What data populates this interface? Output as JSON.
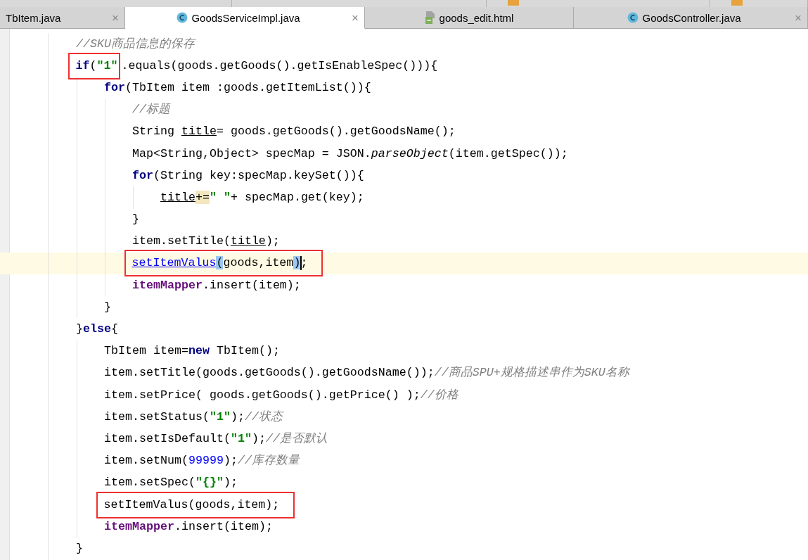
{
  "upper_tabs": [
    {
      "kind": "plain"
    },
    {
      "kind": "plain"
    },
    {
      "kind": "script"
    },
    {
      "kind": "script"
    }
  ],
  "tabs": [
    {
      "kind": "plain",
      "label": "TbItem.java",
      "close": "×",
      "selected": false
    },
    {
      "kind": "class",
      "label": "GoodsServiceImpl.java",
      "close": "×",
      "selected": true
    },
    {
      "kind": "html",
      "label": "goods_edit.html",
      "selected": false
    },
    {
      "kind": "class",
      "label": "GoodsController.java",
      "close": "×",
      "selected": false
    }
  ],
  "editor": {
    "lines": [
      {
        "current": false,
        "tokens": [
          {
            "kind": "comment",
            "text": "//SKU商品信息的保存"
          }
        ]
      },
      {
        "current": false,
        "segments": [
          {
            "kind": "framed",
            "tokens": [
              {
                "kind": "keyword",
                "text": "if"
              },
              {
                "kind": "plain",
                "text": "("
              },
              {
                "kind": "string",
                "text": "\"1\""
              }
            ]
          },
          {
            "kind": "plain",
            "tokens": [
              {
                "kind": "plain",
                "text": ".equals(goods.getGoods().getIsEnableSpec())){"
              }
            ]
          }
        ],
        "children": [
          {
            "current": false,
            "tokens": [
              {
                "kind": "keyword",
                "text": "for"
              },
              {
                "kind": "plain",
                "text": "(TbItem item :goods.getItemList()){"
              }
            ],
            "children": [
              {
                "current": false,
                "tokens": [
                  {
                    "kind": "comment",
                    "text": "//标题"
                  }
                ]
              },
              {
                "current": false,
                "tokens": [
                  {
                    "kind": "plain",
                    "text": "String "
                  },
                  {
                    "kind": "local",
                    "text": "title"
                  },
                  {
                    "kind": "plain",
                    "text": "= goods.getGoods().getGoodsName();"
                  }
                ]
              },
              {
                "current": false,
                "tokens": [
                  {
                    "kind": "plain",
                    "text": "Map<String,Object> specMap = JSON."
                  },
                  {
                    "kind": "static",
                    "text": "parseObject"
                  },
                  {
                    "kind": "plain",
                    "text": "(item.getSpec());"
                  }
                ]
              },
              {
                "current": false,
                "tokens": [
                  {
                    "kind": "keyword",
                    "text": "for"
                  },
                  {
                    "kind": "plain",
                    "text": "(String key:specMap.keySet()){"
                  }
                ],
                "children": [
                  {
                    "current": false,
                    "tokens": [
                      {
                        "kind": "local",
                        "text": "title"
                      },
                      {
                        "kind": "usage",
                        "text": "+="
                      },
                      {
                        "kind": "string",
                        "text": "\" \""
                      },
                      {
                        "kind": "plain",
                        "text": "+ specMap.get(key);"
                      }
                    ]
                  }
                ]
              },
              {
                "current": false,
                "tokens": [
                  {
                    "kind": "plain",
                    "text": "}"
                  }
                ]
              },
              {
                "current": false,
                "tokens": [
                  {
                    "kind": "plain",
                    "text": "item.setTitle("
                  },
                  {
                    "kind": "local",
                    "text": "title"
                  },
                  {
                    "kind": "plain",
                    "text": ");"
                  }
                ]
              },
              {
                "current": true,
                "segments": [
                  {
                    "kind": "framed",
                    "tokens": [
                      {
                        "kind": "link",
                        "text": "setItemValus"
                      },
                      {
                        "kind": "brace_match",
                        "text": "("
                      },
                      {
                        "kind": "plain",
                        "text": "goods,item"
                      },
                      {
                        "kind": "brace_match",
                        "text": ")"
                      },
                      {
                        "kind": "caret"
                      },
                      {
                        "kind": "plain",
                        "text": ";"
                      }
                    ]
                  }
                ]
              },
              {
                "current": false,
                "tokens": [
                  {
                    "kind": "field",
                    "text": "itemMapper"
                  },
                  {
                    "kind": "plain",
                    "text": ".insert(item);"
                  }
                ]
              }
            ]
          },
          {
            "current": false,
            "tokens": [
              {
                "kind": "plain",
                "text": "}"
              }
            ]
          }
        ]
      },
      {
        "current": false,
        "tokens": [
          {
            "kind": "plain",
            "text": "}"
          },
          {
            "kind": "keyword",
            "text": "else"
          },
          {
            "kind": "plain",
            "text": "{"
          }
        ],
        "children": [
          {
            "current": false,
            "tokens": [
              {
                "kind": "plain",
                "text": "TbItem item="
              },
              {
                "kind": "keyword",
                "text": "new"
              },
              {
                "kind": "plain",
                "text": " TbItem();"
              }
            ]
          },
          {
            "current": false,
            "tokens": [
              {
                "kind": "plain",
                "text": "item.setTitle(goods.getGoods().getGoodsName());"
              },
              {
                "kind": "comment",
                "text": "//商品SPU+规格描述串作为SKU名称"
              }
            ]
          },
          {
            "current": false,
            "tokens": [
              {
                "kind": "plain",
                "text": "item.setPrice( goods.getGoods().getPrice() );"
              },
              {
                "kind": "comment",
                "text": "//价格"
              }
            ]
          },
          {
            "current": false,
            "tokens": [
              {
                "kind": "plain",
                "text": "item.setStatus("
              },
              {
                "kind": "string",
                "text": "\"1\""
              },
              {
                "kind": "plain",
                "text": ");"
              },
              {
                "kind": "comment",
                "text": "//状态"
              }
            ]
          },
          {
            "current": false,
            "tokens": [
              {
                "kind": "plain",
                "text": "item.setIsDefault("
              },
              {
                "kind": "string",
                "text": "\"1\""
              },
              {
                "kind": "plain",
                "text": ");"
              },
              {
                "kind": "comment",
                "text": "//是否默认"
              }
            ]
          },
          {
            "current": false,
            "tokens": [
              {
                "kind": "plain",
                "text": "item.setNum("
              },
              {
                "kind": "number",
                "text": "99999"
              },
              {
                "kind": "plain",
                "text": ");"
              },
              {
                "kind": "comment",
                "text": "//库存数量"
              }
            ]
          },
          {
            "current": false,
            "tokens": [
              {
                "kind": "plain",
                "text": "item.setSpec("
              },
              {
                "kind": "string",
                "text": "\"{}\""
              },
              {
                "kind": "plain",
                "text": ");"
              }
            ]
          },
          {
            "current": false,
            "segments": [
              {
                "kind": "framed",
                "tokens": [
                  {
                    "kind": "plain",
                    "text": "setItemValus(goods,item);"
                  }
                ]
              }
            ]
          },
          {
            "current": false,
            "tokens": [
              {
                "kind": "field",
                "text": "itemMapper"
              },
              {
                "kind": "plain",
                "text": ".insert(item);"
              }
            ]
          }
        ]
      },
      {
        "current": false,
        "tokens": [
          {
            "kind": "plain",
            "text": "}"
          }
        ]
      }
    ]
  }
}
